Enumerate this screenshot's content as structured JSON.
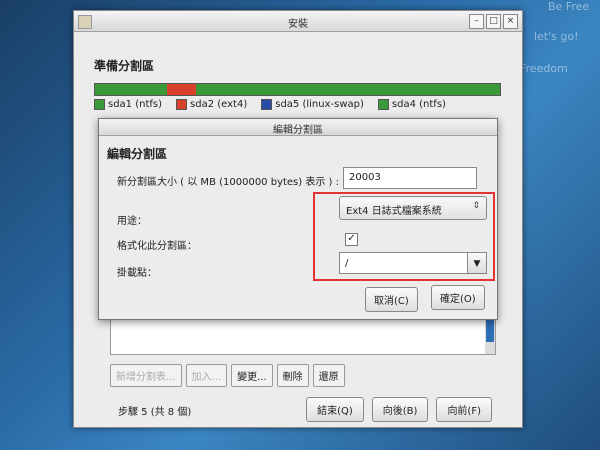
{
  "background_text": [
    "Be Free",
    "let's go!",
    "Freedom"
  ],
  "window": {
    "title": "安裝"
  },
  "main": {
    "title": "準備分割區",
    "disk_segments": [
      {
        "color": "#3a9a3a",
        "flex": 25
      },
      {
        "color": "#d8402c",
        "flex": 10
      },
      {
        "color": "#3a9a3a",
        "flex": 105
      }
    ],
    "legend": [
      {
        "label": "sda1 (ntfs)",
        "color": "#3a9a3a"
      },
      {
        "label": "sda2 (ext4)",
        "color": "#d8402c"
      },
      {
        "label": "sda5 (linux-swap)",
        "color": "#2a4aa8"
      },
      {
        "label": "sda4 (ntfs)",
        "color": "#3a9a3a"
      }
    ],
    "actions": {
      "new": "新增分割表...",
      "add": "加入...",
      "change": "變更...",
      "delete": "刪除",
      "reset": "還原"
    },
    "step": "步驟 5 (共 8 個)",
    "nav": {
      "quit": "結束(Q)",
      "back": "向後(B)",
      "forward": "向前(F)"
    }
  },
  "dialog": {
    "title": "編輯分割區",
    "header": "編輯分割區",
    "size_label": "新分割區大小 ( 以 MB (1000000 bytes) 表示 ) :",
    "size_value": "20003",
    "use_label": "用途：",
    "use_value": "Ext4 日誌式檔案系統",
    "format_label": "格式化此分割區：",
    "format_checked": "✓",
    "mount_label": "掛載點：",
    "mount_value": "/",
    "cancel": "取消(C)",
    "ok": "確定(O)"
  }
}
